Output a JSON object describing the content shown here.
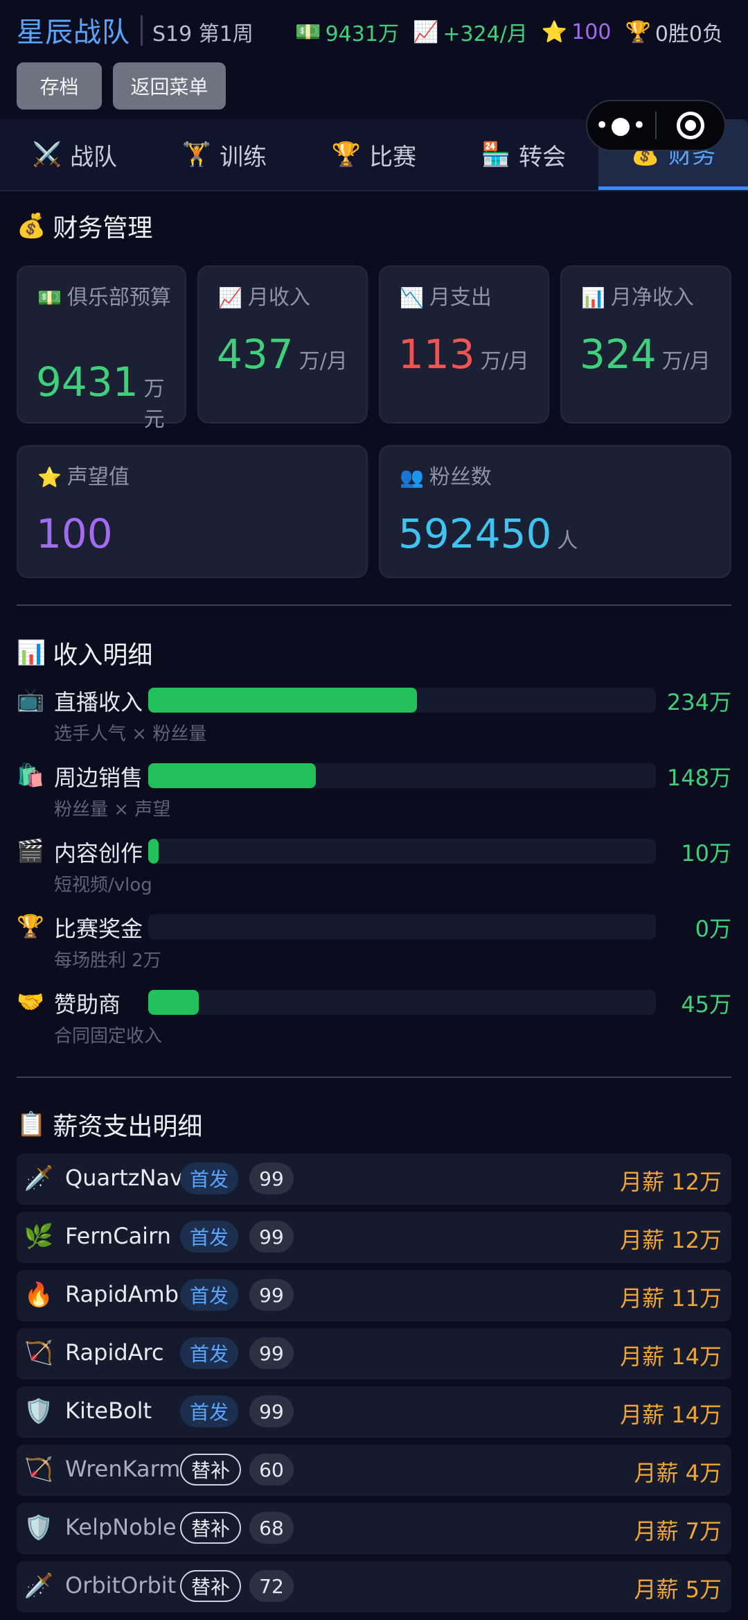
{
  "header": {
    "team_name": "星辰战队",
    "season": "S19 第1周",
    "stats": [
      {
        "icon": "💵",
        "text": "9431万",
        "color": "green",
        "name": "budget-stat"
      },
      {
        "icon": "📈",
        "text": "+324/月",
        "color": "green",
        "name": "net-income-stat"
      },
      {
        "icon": "⭐",
        "text": "100",
        "color": "purple",
        "name": "prestige-stat"
      },
      {
        "icon": "🏆",
        "text": "0胜0负",
        "color": "gray",
        "name": "record-stat"
      }
    ],
    "buttons": {
      "save": "存档",
      "back": "返回菜单"
    }
  },
  "capsule": {
    "more": "•●•"
  },
  "tabs": [
    {
      "icon": "⚔️",
      "label": "战队",
      "active": false
    },
    {
      "icon": "🏋️",
      "label": "训练",
      "active": false
    },
    {
      "icon": "🏆",
      "label": "比赛",
      "active": false
    },
    {
      "icon": "🏪",
      "label": "转会",
      "active": false
    },
    {
      "icon": "💰",
      "label": "财务",
      "active": true
    }
  ],
  "finance": {
    "title_icon": "💰",
    "title": "财务管理",
    "cards": [
      {
        "icon": "💵",
        "label": "俱乐部预算",
        "value": "9431",
        "unit": "万元",
        "color": "green"
      },
      {
        "icon": "📈",
        "label": "月收入",
        "value": "437",
        "unit": "万/月",
        "color": "green"
      },
      {
        "icon": "📉",
        "label": "月支出",
        "value": "113",
        "unit": "万/月",
        "color": "red"
      },
      {
        "icon": "📊",
        "label": "月净收入",
        "value": "324",
        "unit": "万/月",
        "color": "green"
      },
      {
        "icon": "⭐",
        "label": "声望值",
        "value": "100",
        "unit": "",
        "color": "purple"
      },
      {
        "icon": "👥",
        "label": "粉丝数",
        "value": "592450",
        "unit": "人",
        "color": "cyan"
      }
    ]
  },
  "income": {
    "title_icon": "📊",
    "title": "收入明细",
    "max_value": 234,
    "items": [
      {
        "icon": "📺",
        "name": "直播收入",
        "amount": "234万",
        "value": 234,
        "fill_pct": 53,
        "desc": "选手人气 × 粉丝量"
      },
      {
        "icon": "🛍️",
        "name": "周边销售",
        "amount": "148万",
        "value": 148,
        "fill_pct": 33,
        "desc": "粉丝量 × 声望"
      },
      {
        "icon": "🎬",
        "name": "内容创作",
        "amount": "10万",
        "value": 10,
        "fill_pct": 2,
        "desc": "短视频/vlog"
      },
      {
        "icon": "🏆",
        "name": "比赛奖金",
        "amount": "0万",
        "value": 0,
        "fill_pct": 0,
        "desc": "每场胜利 2万"
      },
      {
        "icon": "🤝",
        "name": "赞助商",
        "amount": "45万",
        "value": 45,
        "fill_pct": 10,
        "desc": "合同固定收入"
      }
    ]
  },
  "salary": {
    "title_icon": "📋",
    "title": "薪资支出明细",
    "rows": [
      {
        "icon": "🗡️",
        "name": "QuartzNav",
        "role": "首发",
        "role_type": "start",
        "ovr": "99",
        "salary": "月薪 12万"
      },
      {
        "icon": "🌿",
        "name": "FernCairn",
        "role": "首发",
        "role_type": "start",
        "ovr": "99",
        "salary": "月薪 12万"
      },
      {
        "icon": "🔥",
        "name": "RapidAmb",
        "role": "首发",
        "role_type": "start",
        "ovr": "99",
        "salary": "月薪 11万"
      },
      {
        "icon": "🏹",
        "name": "RapidArc",
        "role": "首发",
        "role_type": "start",
        "ovr": "99",
        "salary": "月薪 14万"
      },
      {
        "icon": "🛡️",
        "name": "KiteBolt",
        "role": "首发",
        "role_type": "start",
        "ovr": "99",
        "salary": "月薪 14万"
      },
      {
        "icon": "🏹",
        "name": "WrenKarm",
        "role": "替补",
        "role_type": "bench",
        "ovr": "60",
        "salary": "月薪 4万"
      },
      {
        "icon": "🛡️",
        "name": "KelpNoble",
        "role": "替补",
        "role_type": "bench",
        "ovr": "68",
        "salary": "月薪 7万"
      },
      {
        "icon": "🗡️",
        "name": "OrbitOrbit",
        "role": "替补",
        "role_type": "bench",
        "ovr": "72",
        "salary": "月薪 5万"
      }
    ]
  }
}
